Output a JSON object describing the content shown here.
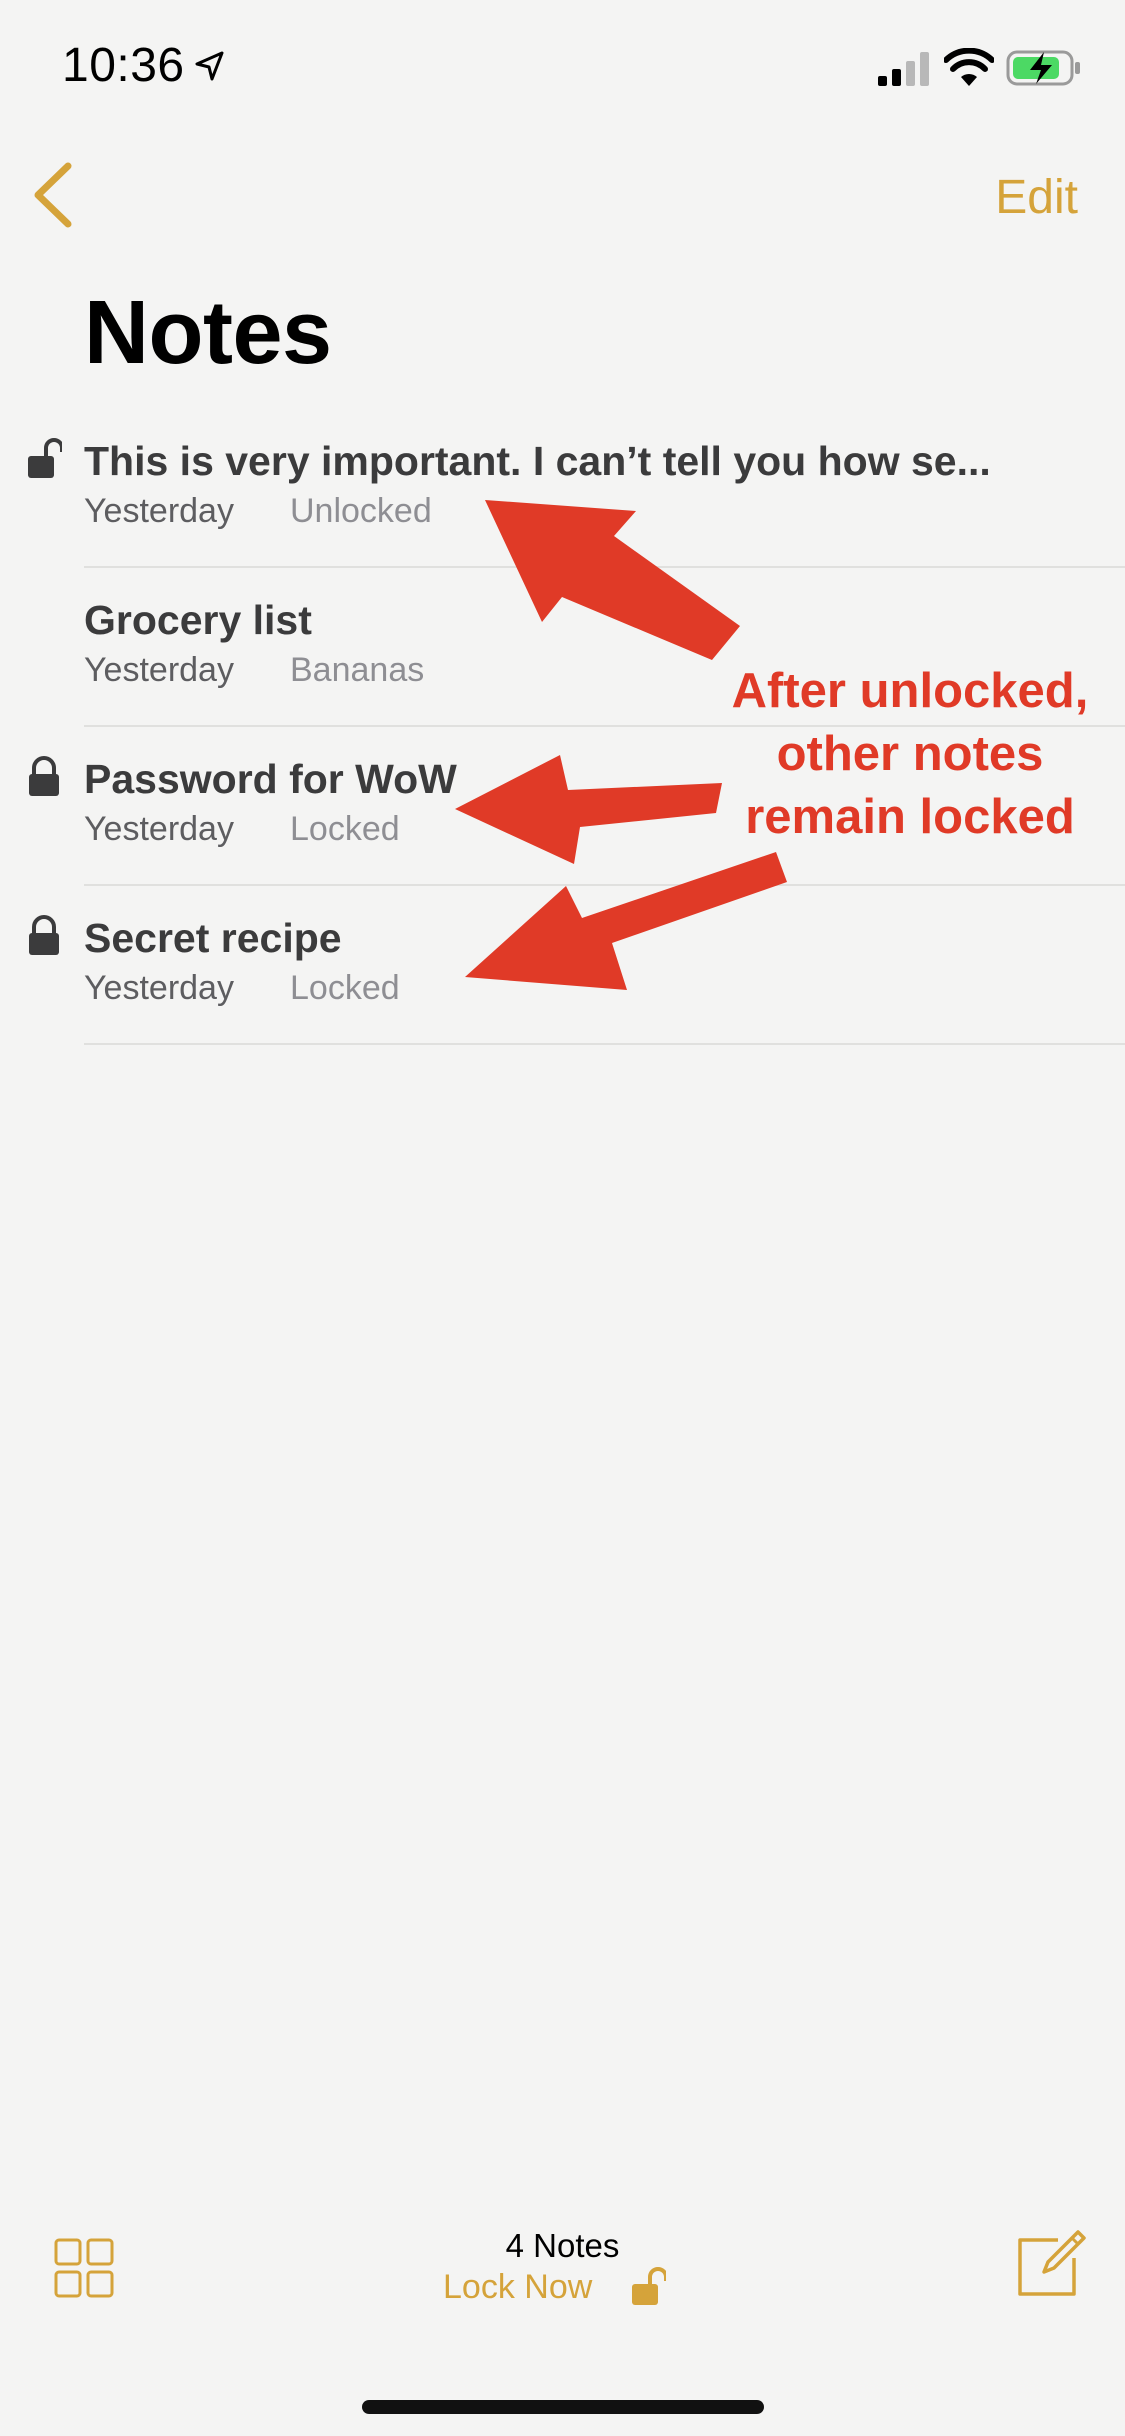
{
  "status_bar": {
    "time": "10:36"
  },
  "nav": {
    "edit_label": "Edit"
  },
  "page": {
    "title": "Notes"
  },
  "notes": [
    {
      "title": "This is very important. I can’t tell you how se...",
      "date": "Yesterday",
      "preview": "Unlocked",
      "lock": "unlocked"
    },
    {
      "title": "Grocery list",
      "date": "Yesterday",
      "preview": "Bananas",
      "lock": "none"
    },
    {
      "title": "Password for WoW",
      "date": "Yesterday",
      "preview": "Locked",
      "lock": "locked"
    },
    {
      "title": "Secret recipe",
      "date": "Yesterday",
      "preview": "Locked",
      "lock": "locked"
    }
  ],
  "annotation": {
    "lines": [
      "After unlocked,",
      "other notes",
      "remain locked"
    ],
    "color": "#e03a27"
  },
  "toolbar": {
    "count_label": "4 Notes",
    "lock_now_label": "Lock Now"
  },
  "colors": {
    "accent": "#d5a33a",
    "background": "#f4f4f3"
  }
}
